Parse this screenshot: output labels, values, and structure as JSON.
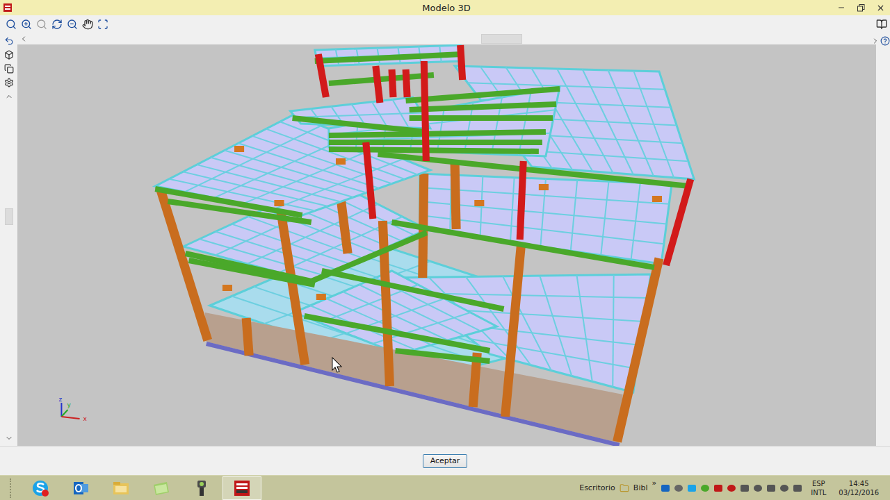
{
  "window": {
    "title": "Modelo 3D"
  },
  "viewport": {
    "axis_labels": [
      "z",
      "y",
      "x"
    ]
  },
  "buttons": [
    {
      "label": "Aceptar"
    }
  ],
  "taskbar": {
    "apps": [
      {
        "kind": "skype",
        "selected": false
      },
      {
        "kind": "outlook",
        "selected": false
      },
      {
        "kind": "explorer",
        "selected": false
      },
      {
        "kind": "folder",
        "selected": false
      },
      {
        "kind": "tool",
        "selected": false
      },
      {
        "kind": "cype",
        "selected": true
      }
    ],
    "toolbar_label": "Escritorio",
    "library": {
      "label": "Bibl",
      "overflow": "»"
    },
    "language": {
      "code": "ESP",
      "layout": "INTL"
    },
    "clock": {
      "time": "14:45",
      "date": "03/12/2016"
    }
  }
}
